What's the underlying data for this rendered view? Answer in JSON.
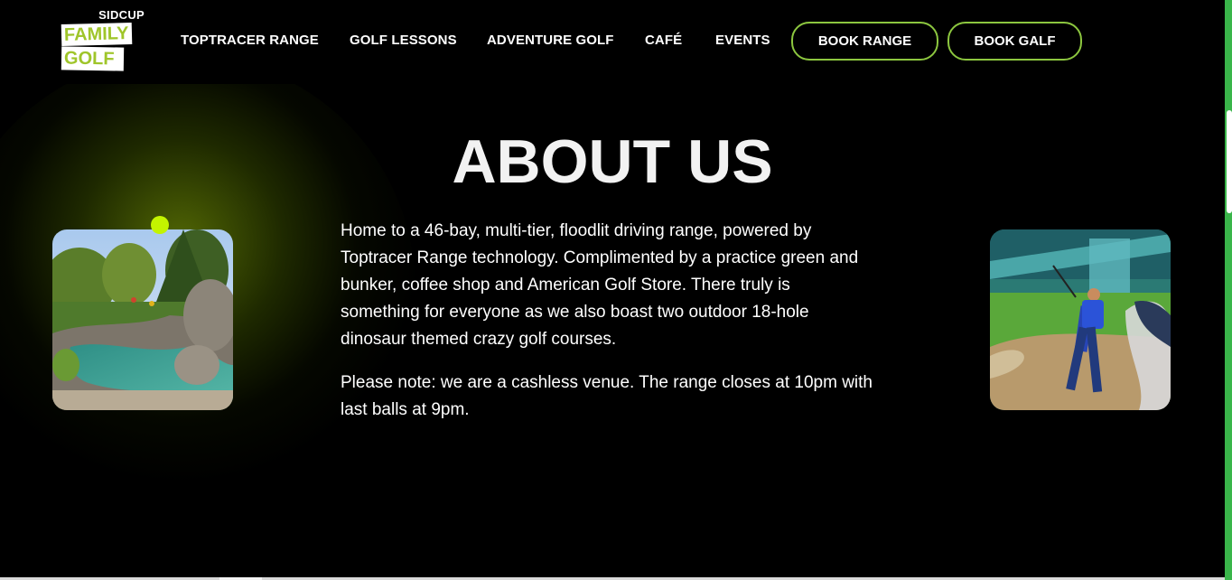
{
  "brand": {
    "location": "SIDCUP",
    "line1": "FAMILY",
    "line2": "GOLF",
    "accent_color": "#9fc52a"
  },
  "nav": {
    "links": [
      "TOPTRACER RANGE",
      "GOLF LESSONS",
      "ADVENTURE GOLF",
      "CAFÉ",
      "EVENTS"
    ],
    "book_range": "BOOK RANGE",
    "book_golf": "BOOK GALF",
    "button_border_color": "#8cc63f"
  },
  "about": {
    "heading": "ABOUT US",
    "paragraph1": "Home to a 46-bay, multi-tier, floodlit driving range, powered by Toptracer Range technology. Complimented by a practice green and bunker, coffee shop and American Golf Store. There truly is something for everyone as we also boast two outdoor 18-hole dinosaur themed crazy golf courses.",
    "paragraph2": "Please note: we are a cashless venue. The range closes at 10pm with last balls at 9pm."
  },
  "images": {
    "left": "adventure-golf-course-photo",
    "right": "golfer-bunker-shot-photo"
  },
  "decor": {
    "dot_color": "#c3f400",
    "glow_color": "#5f7805"
  }
}
